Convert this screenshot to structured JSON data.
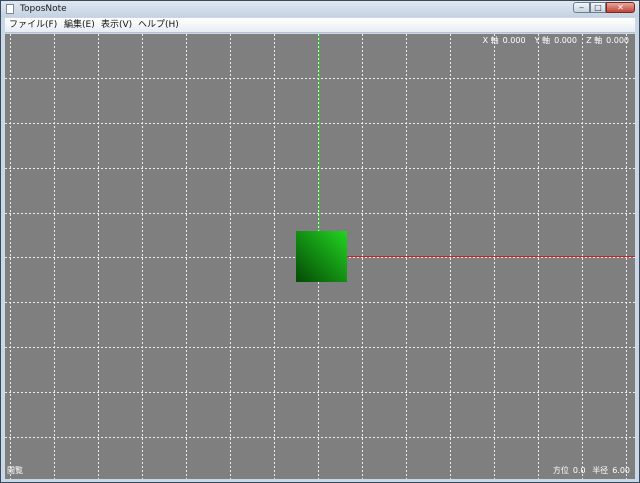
{
  "window": {
    "title": "ToposNote",
    "controls": {
      "minimize": "‒",
      "maximize": "□",
      "close": "✕"
    }
  },
  "menu": [
    "ファイル(F)",
    "編集(E)",
    "表示(V)",
    "ヘルプ(H)"
  ],
  "hud": {
    "x_label": "X 軸",
    "x_value": "0.000",
    "y_label": "Y 軸",
    "y_value": "0.000",
    "z_label": "Z 軸",
    "z_value": "0.000"
  },
  "status": {
    "left": "閲覧",
    "azimuth_label": "方位",
    "azimuth_value": "0.0",
    "radius_label": "半径",
    "radius_value": "6.00"
  },
  "colors": {
    "viewport": "#7f7f7f",
    "grid": "#ffffff",
    "x_axis": "#d22020",
    "y_axis": "#2ec82e",
    "cube_light": "#22d422",
    "cube_dark": "#044a04"
  }
}
